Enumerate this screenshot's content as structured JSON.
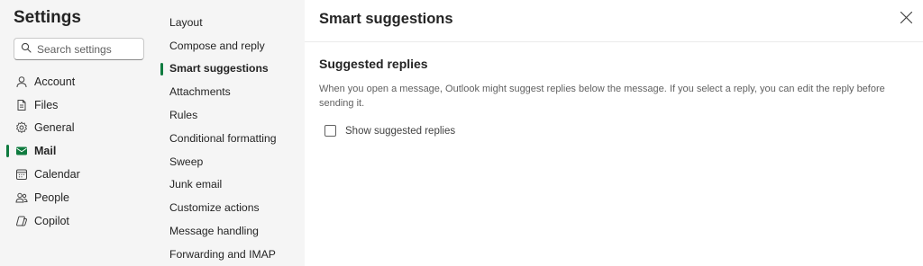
{
  "settings": {
    "title": "Settings",
    "search_placeholder": "Search settings"
  },
  "categories": [
    {
      "label": "Account",
      "icon": "person-icon"
    },
    {
      "label": "Files",
      "icon": "document-icon"
    },
    {
      "label": "General",
      "icon": "gear-icon"
    },
    {
      "label": "Mail",
      "icon": "mail-icon",
      "selected": true
    },
    {
      "label": "Calendar",
      "icon": "calendar-icon"
    },
    {
      "label": "People",
      "icon": "people-icon"
    },
    {
      "label": "Copilot",
      "icon": "copilot-icon"
    }
  ],
  "mail_subsections": [
    {
      "label": "Layout"
    },
    {
      "label": "Compose and reply"
    },
    {
      "label": "Smart suggestions",
      "selected": true
    },
    {
      "label": "Attachments"
    },
    {
      "label": "Rules"
    },
    {
      "label": "Conditional formatting"
    },
    {
      "label": "Sweep"
    },
    {
      "label": "Junk email"
    },
    {
      "label": "Customize actions"
    },
    {
      "label": "Message handling"
    },
    {
      "label": "Forwarding and IMAP"
    }
  ],
  "panel": {
    "title": "Smart suggestions",
    "section_title": "Suggested replies",
    "description": "When you open a message, Outlook might suggest replies below the message. If you select a reply, you can edit the reply before sending it.",
    "checkbox_label": "Show suggested replies",
    "checkbox_checked": false
  },
  "colors": {
    "accent": "#0f7b3f",
    "sidebar_bg": "#f5f5f5"
  }
}
